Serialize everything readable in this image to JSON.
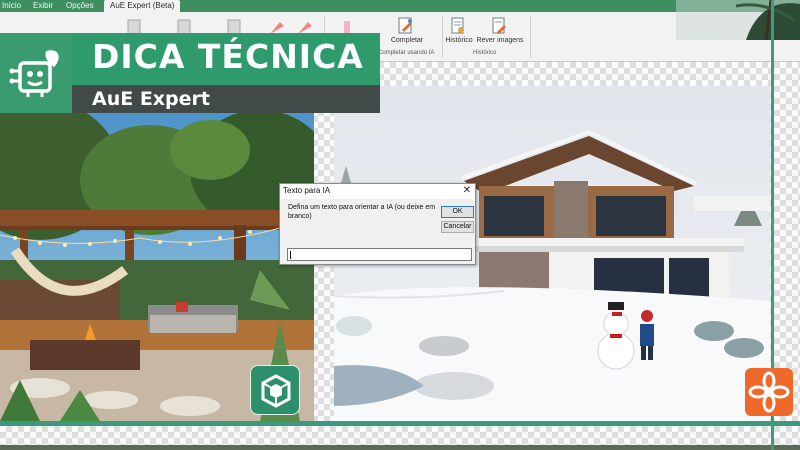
{
  "menu": {
    "items": [
      {
        "label": "Início",
        "active": false
      },
      {
        "label": "Exibir",
        "active": false
      },
      {
        "label": "Opções",
        "active": false
      },
      {
        "label": "AuE Expert (Beta)",
        "active": true
      }
    ]
  },
  "ribbon": {
    "buttons": [
      {
        "label": "Completar",
        "icon": "ai-complete-icon"
      },
      {
        "label": "Histórico",
        "icon": "history-icon"
      },
      {
        "label": "Rever imagens",
        "icon": "review-images-icon"
      }
    ],
    "groups": [
      {
        "label": "Completar usando IA"
      },
      {
        "label": "Histórico"
      }
    ]
  },
  "banner": {
    "title": "DICA TÉCNICA",
    "subtitle": "AuE Expert",
    "logo_icon": "robot-leaf-icon"
  },
  "dialog": {
    "title": "Texto para IA",
    "prompt": "Defina um texto para orientar a IA (ou deixe em branco)",
    "ok_label": "OK",
    "cancel_label": "Cancelar",
    "input_value": "",
    "close_icon": "close-icon"
  },
  "badges": {
    "aue_logo_icon": "aue-cube-logo-icon",
    "flower_logo_icon": "flower-logo-icon"
  },
  "colors": {
    "brand_green": "#2f9a6c",
    "banner_dark": "#414a49",
    "menubar_green": "#3e8e60",
    "accent_orange": "#ef6a2a",
    "guide_teal": "#3d9a84"
  }
}
